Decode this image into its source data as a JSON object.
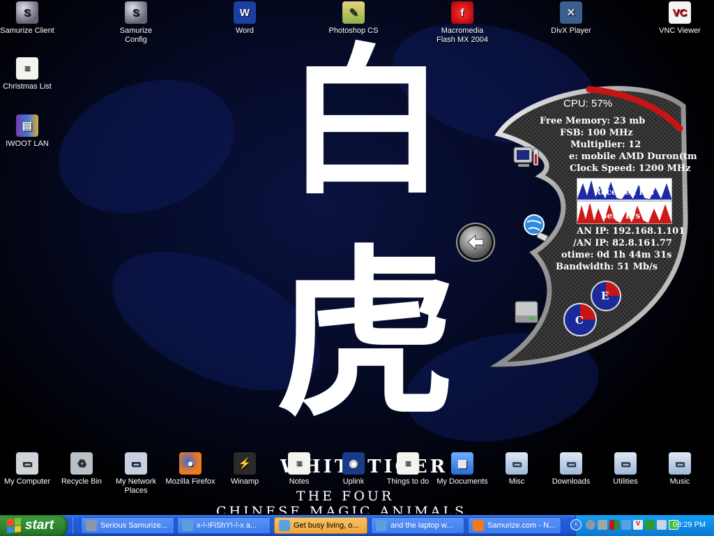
{
  "desktop": {
    "wallpaper": {
      "calligraphy": "白虎",
      "brand_text": "WHITETIGER",
      "subtitle": "THE FOUR",
      "subtitle2": "CHINESE MAGIC ANIMALS"
    },
    "top_icons": [
      {
        "label": "Samurize Client",
        "icon": "samurize-client-icon",
        "color": "#8a97a8"
      },
      {
        "label": "Samurize Config",
        "icon": "samurize-config-icon",
        "color": "#8a97a8"
      },
      {
        "label": "Word",
        "icon": "word-icon",
        "color": "#1b3fa3"
      },
      {
        "label": "Photoshop CS",
        "icon": "photoshop-icon",
        "color": "#8fb34a"
      },
      {
        "label": "Macromedia Flash MX 2004",
        "icon": "flash-icon",
        "color": "#d42020"
      },
      {
        "label": "DivX Player",
        "icon": "divx-icon",
        "color": "#3b5f8c"
      },
      {
        "label": "VNC Viewer",
        "icon": "vnc-icon",
        "color": "#e8e8e8"
      }
    ],
    "left_icons": [
      {
        "label": "Christmas List",
        "icon": "text-file-icon"
      },
      {
        "label": "IWOOT LAN",
        "icon": "winrar-archive-icon"
      }
    ],
    "bottom_icons": [
      {
        "label": "My Computer",
        "icon": "my-computer-icon"
      },
      {
        "label": "Recycle Bin",
        "icon": "recycle-bin-icon"
      },
      {
        "label": "My Network Places",
        "icon": "network-places-icon"
      },
      {
        "label": "Mozilla Firefox",
        "icon": "firefox-icon"
      },
      {
        "label": "Winamp",
        "icon": "winamp-icon"
      },
      {
        "label": "Notes",
        "icon": "notes-file-icon"
      },
      {
        "label": "Uplink",
        "icon": "uplink-icon"
      },
      {
        "label": "Things to do",
        "icon": "text-file-icon"
      },
      {
        "label": "My Documents",
        "icon": "my-documents-icon"
      },
      {
        "label": "Misc",
        "icon": "folder-icon"
      },
      {
        "label": "Downloads",
        "icon": "folder-icon"
      },
      {
        "label": "Utilities",
        "icon": "folder-icon"
      },
      {
        "label": "Music",
        "icon": "folder-icon"
      }
    ]
  },
  "samurize": {
    "cpu": "CPU: 57%",
    "cpu_percent": 57,
    "free_memory": "Free Memory: 23 mb",
    "fsb": "FSB: 100 MHz",
    "multiplier": "Multiplier: 12",
    "cpu_name": "e: mobile AMD  Duron(tm",
    "clock_speed": "Clock Speed: 1200 MHz",
    "received_label": "Received K/s",
    "sent_label": "Sent K/s",
    "lan_ip": "AN IP: 192.168.1.101",
    "wan_ip": "/AN IP: 82.8.161.77",
    "uptime": "otime: 0d 1h 44m 31s",
    "bandwidth": "Bandwidth: 51 Mb/s",
    "drive_e": "E",
    "drive_c": "C",
    "accent": "#d01818"
  },
  "taskbar": {
    "start_label": "start",
    "tasks": [
      {
        "label": "Serious Samurize...",
        "active": false,
        "icon": "samurize-task-icon"
      },
      {
        "label": "x-!-!FiShY!-!-x a...",
        "active": false,
        "icon": "msn-task-icon"
      },
      {
        "label": "Get busy living, o...",
        "active": true,
        "icon": "msn-task-icon"
      },
      {
        "label": "and the laptop w...",
        "active": false,
        "icon": "msn-task-icon"
      },
      {
        "label": "Samurize.com - N...",
        "active": false,
        "icon": "firefox-task-icon"
      }
    ],
    "clock": "03:29 PM"
  }
}
